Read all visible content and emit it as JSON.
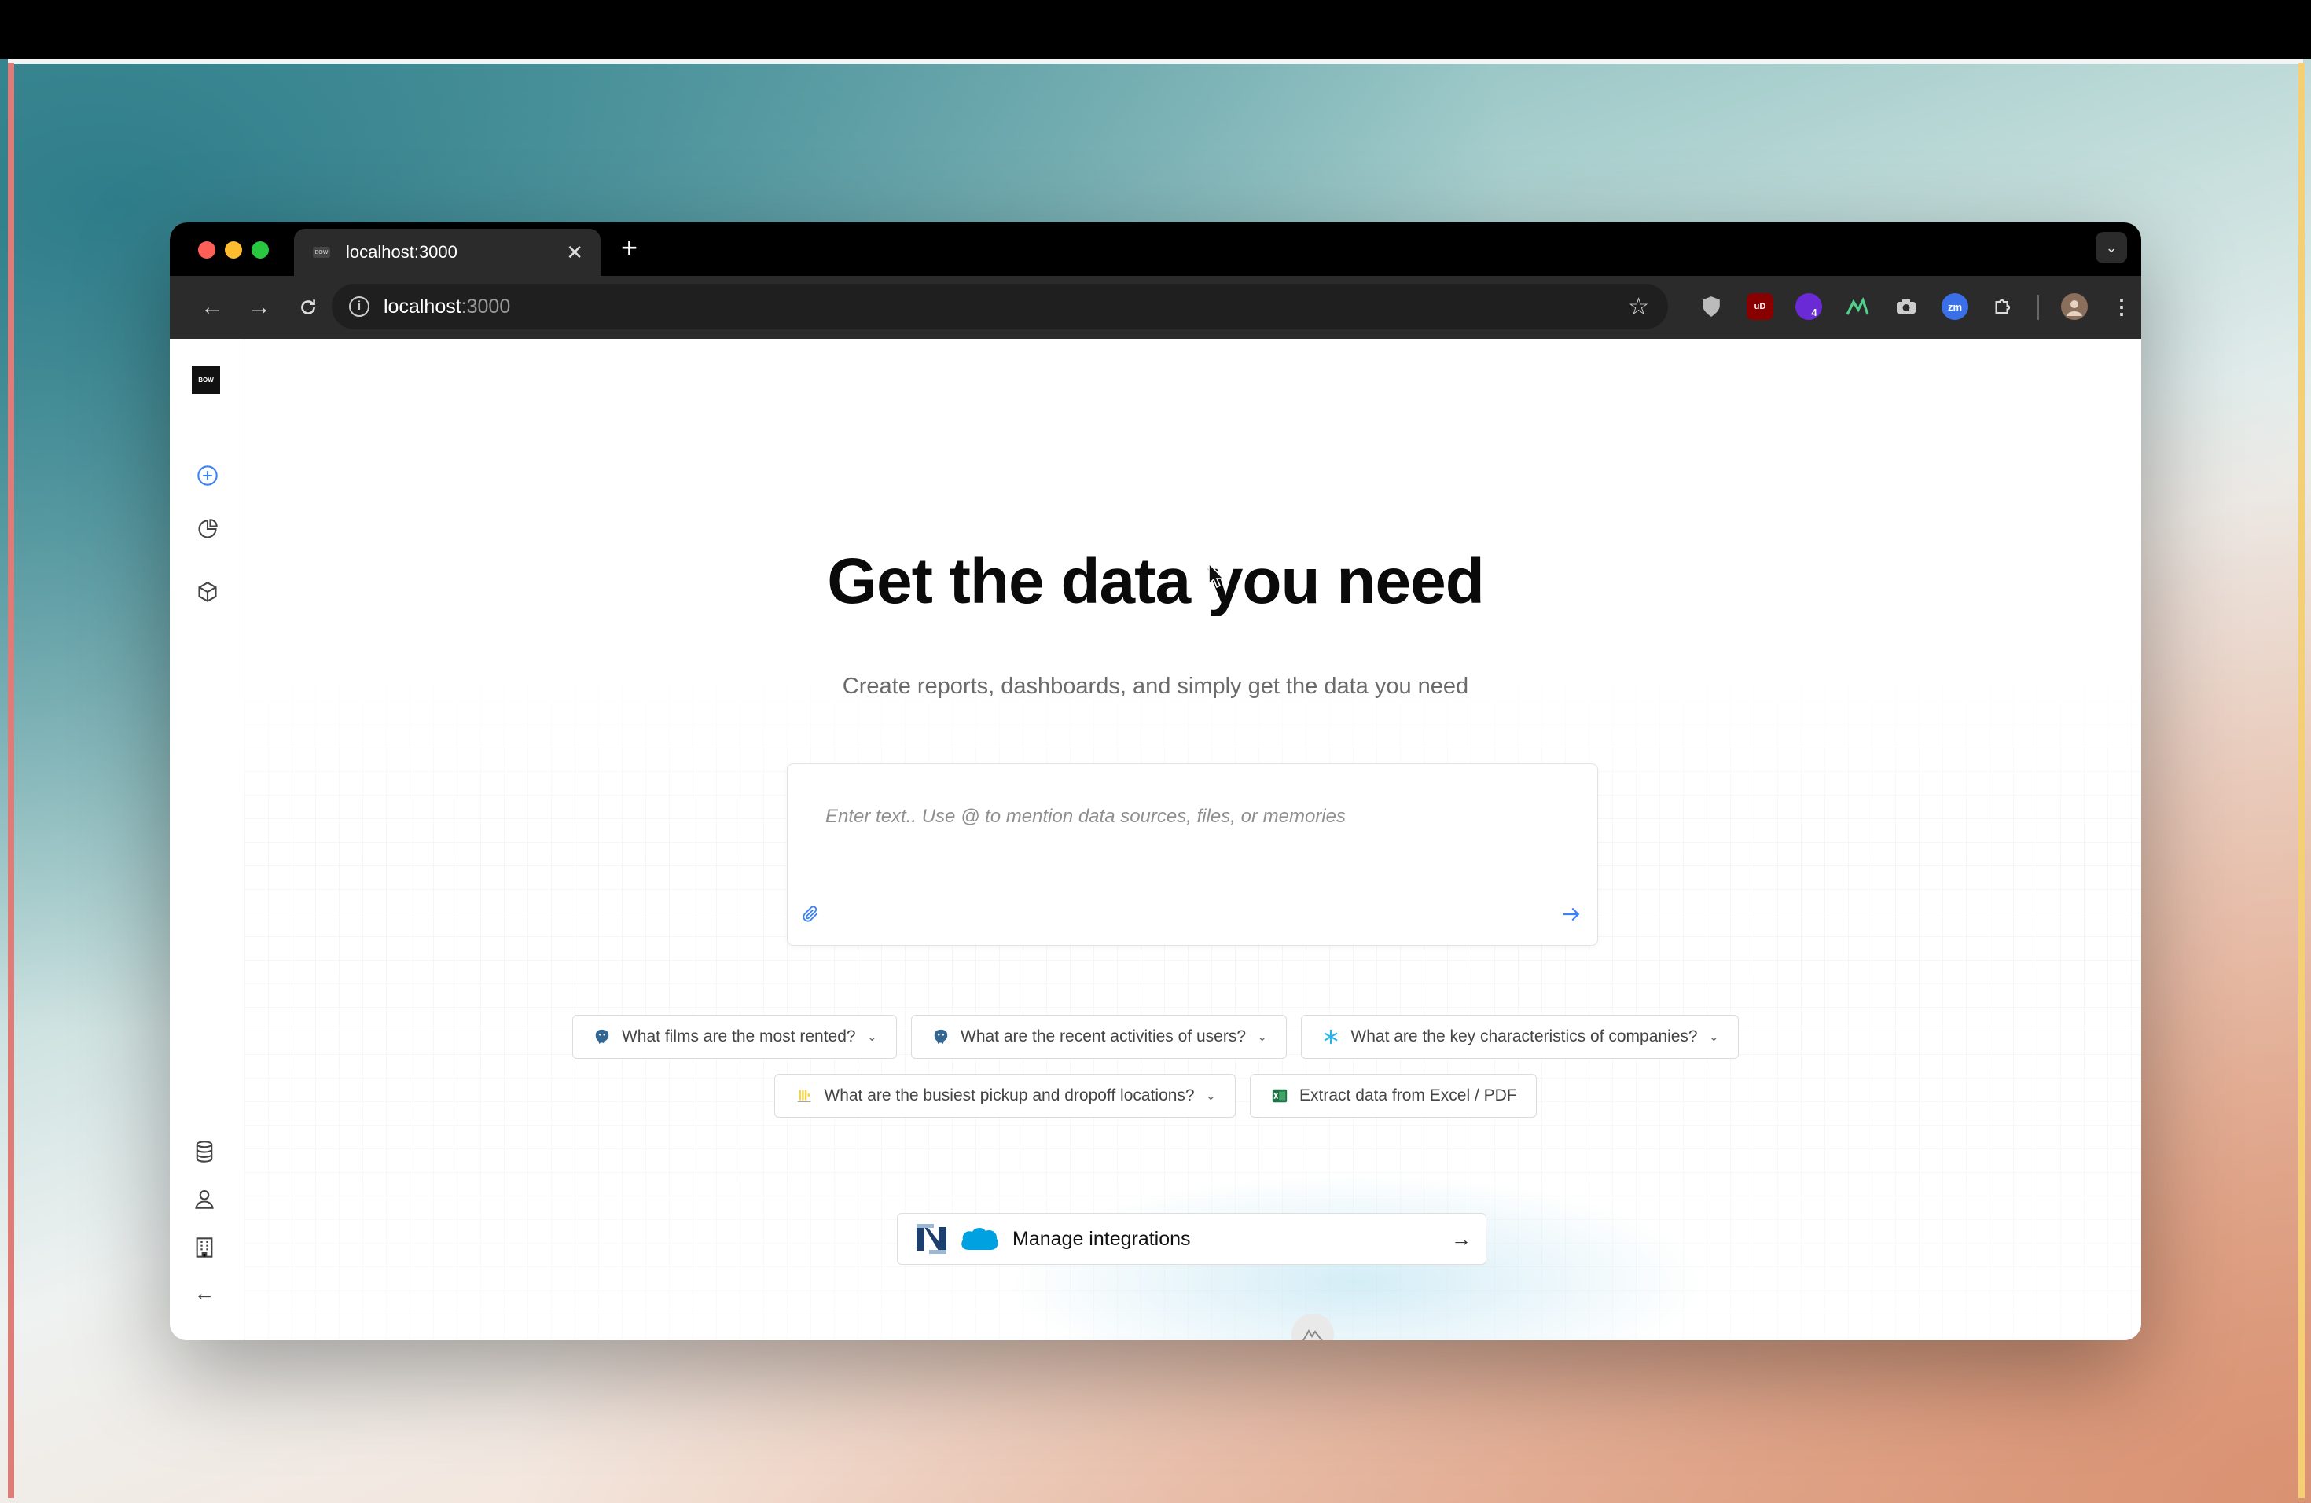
{
  "browser": {
    "tab_title": "localhost:3000",
    "tab_favicon_text": "BOW",
    "address_host": "localhost",
    "address_port": ":3000",
    "extension_badge": "4",
    "extension_zm": "zm",
    "extension_ub": "uD"
  },
  "sidebar": {
    "logo_text": "BOW"
  },
  "hero": {
    "title": "Get the data you need",
    "subtitle": "Create reports, dashboards, and simply get the data you need"
  },
  "prompt": {
    "placeholder": "Enter text.. Use @ to mention data sources, files, or memories"
  },
  "suggestions_row1": [
    {
      "label": "What films are the most rented?",
      "icon": "postgres-icon"
    },
    {
      "label": "What are the recent activities of users?",
      "icon": "postgres-icon"
    },
    {
      "label": "What are the key characteristics of companies?",
      "icon": "snowflake-icon"
    }
  ],
  "suggestions_row2": [
    {
      "label": "What are the busiest pickup and dropoff locations?",
      "icon": "clickhouse-icon"
    },
    {
      "label": "Extract data from Excel / PDF",
      "icon": "excel-icon"
    }
  ],
  "integrations": {
    "label": "Manage integrations"
  },
  "colors": {
    "accent": "#3b82f6",
    "traffic_red": "#ff5f57",
    "traffic_yellow": "#febc2e",
    "traffic_green": "#28c840"
  }
}
